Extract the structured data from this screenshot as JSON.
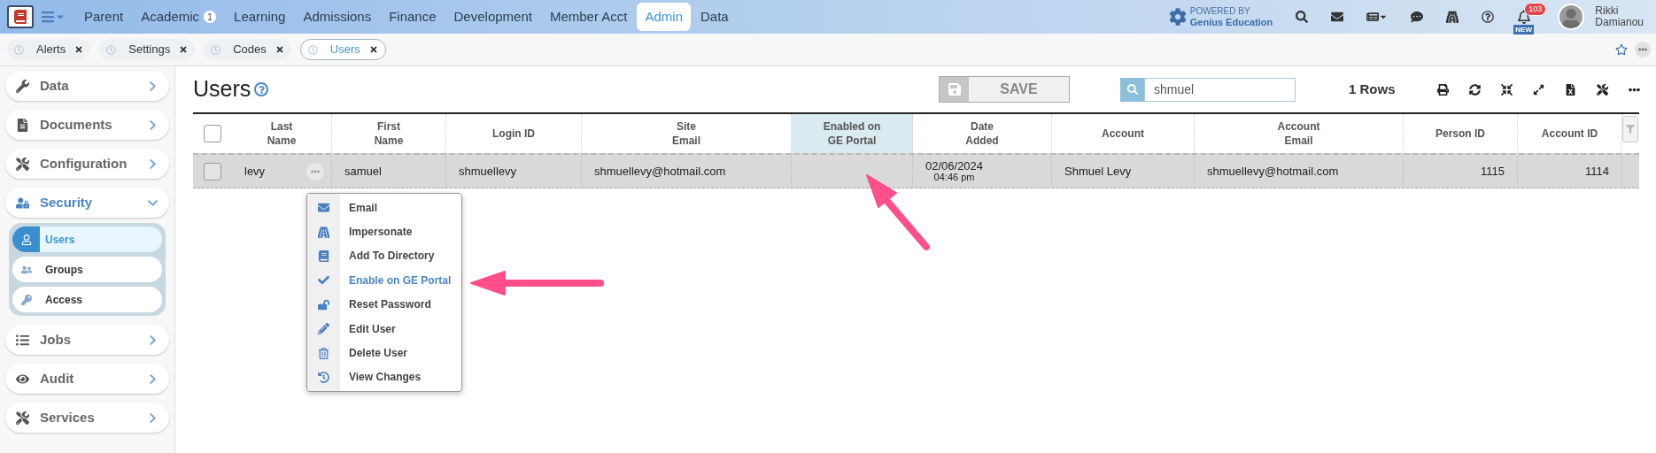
{
  "top_nav": {
    "items": [
      {
        "label": "Parent",
        "selected": false
      },
      {
        "label": "Academic",
        "selected": false,
        "badge": "1"
      },
      {
        "label": "Learning",
        "selected": false
      },
      {
        "label": "Admissions",
        "selected": false
      },
      {
        "label": "Finance",
        "selected": false
      },
      {
        "label": "Development",
        "selected": false
      },
      {
        "label": "Member Acct",
        "selected": false
      },
      {
        "label": "Admin",
        "selected": true
      },
      {
        "label": "Data",
        "selected": false
      }
    ],
    "powered_by": {
      "line1": "POWERED BY",
      "line2": "Genius Education"
    },
    "notifications": {
      "badge": "103",
      "tag": "NEW"
    },
    "user": {
      "first": "Rikki",
      "last": "Damianou"
    }
  },
  "open_tabs": [
    {
      "label": "Alerts",
      "selected": false
    },
    {
      "label": "Settings",
      "selected": false
    },
    {
      "label": "Codes",
      "selected": false
    },
    {
      "label": "Users",
      "selected": true
    }
  ],
  "sidebar": {
    "items": [
      {
        "label": "Data",
        "expanded": false
      },
      {
        "label": "Documents",
        "expanded": false
      },
      {
        "label": "Configuration",
        "expanded": false
      },
      {
        "label": "Security",
        "expanded": true,
        "children": [
          {
            "label": "Users",
            "selected": true
          },
          {
            "label": "Groups",
            "selected": false
          },
          {
            "label": "Access",
            "selected": false
          }
        ]
      },
      {
        "label": "Jobs",
        "expanded": false
      },
      {
        "label": "Audit",
        "expanded": false
      },
      {
        "label": "Services",
        "expanded": false
      }
    ]
  },
  "page": {
    "title": "Users",
    "save_button": {
      "label": "SAVE",
      "disabled": true
    },
    "search": {
      "value": "shmuel"
    },
    "row_count": "1 Rows"
  },
  "table": {
    "select_all": {
      "checked": false
    },
    "columns": [
      {
        "label": "Last\nName",
        "highlighted": false
      },
      {
        "label": "First\nName",
        "highlighted": false
      },
      {
        "label": "Login ID",
        "highlighted": false
      },
      {
        "label": "Site\nEmail",
        "highlighted": false
      },
      {
        "label": "Enabled on\nGE Portal",
        "highlighted": true
      },
      {
        "label": "Date\nAdded",
        "highlighted": false
      },
      {
        "label": "Account",
        "highlighted": false
      },
      {
        "label": "Account\nEmail",
        "highlighted": false
      },
      {
        "label": "Person ID",
        "highlighted": false
      },
      {
        "label": "Account ID",
        "highlighted": false
      }
    ],
    "rows": [
      {
        "checked": false,
        "last_name": "levy",
        "first_name": "samuel",
        "login_id": "shmuellevy",
        "site_email": "shmuellevy@hotmail.com",
        "date": "02/06/2024",
        "time": "04:46 pm",
        "account": "Shmuel Levy",
        "account_email": "shmuellevy@hotmail.com",
        "person_id": "1115",
        "account_id": "1114"
      }
    ]
  },
  "context_menu": {
    "items": [
      {
        "label": "Email",
        "highlighted": false
      },
      {
        "label": "Impersonate",
        "highlighted": false
      },
      {
        "label": "Add To Directory",
        "highlighted": false
      },
      {
        "label": "Enable on GE Portal",
        "highlighted": true
      },
      {
        "label": "Reset Password",
        "highlighted": false
      },
      {
        "label": "Edit User",
        "highlighted": false
      },
      {
        "label": "Delete User",
        "highlighted": false
      },
      {
        "label": "View Changes",
        "highlighted": false
      }
    ]
  }
}
